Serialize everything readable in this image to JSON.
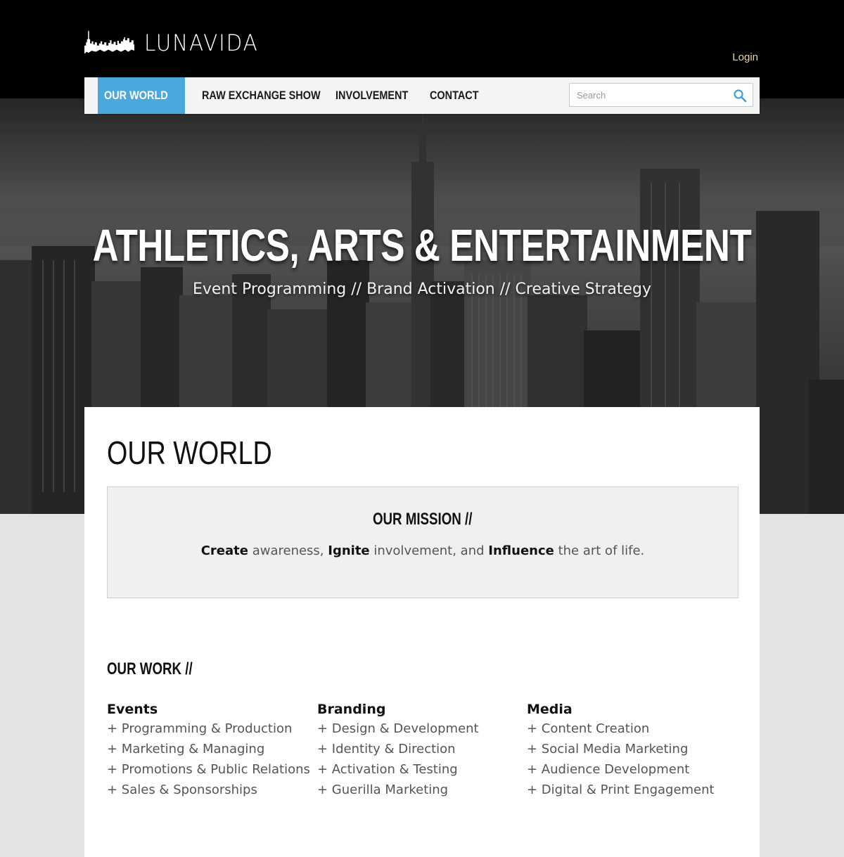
{
  "header": {
    "logo_text": "LUNAVIDA",
    "login_label": "Login"
  },
  "nav": {
    "items": [
      {
        "label": "OUR WORLD",
        "active": true
      },
      {
        "label": "RAW EXCHANGE SHOW",
        "active": false
      },
      {
        "label": "INVOLVEMENT",
        "active": false
      },
      {
        "label": "CONTACT",
        "active": false
      }
    ],
    "search_placeholder": "Search",
    "active_color": "#4aa8dc"
  },
  "hero": {
    "title": "ATHLETICS, ARTS & ENTERTAINMENT",
    "subtitle": "Event Programming // Brand Activation // Creative Strategy"
  },
  "main": {
    "page_title": "OUR WORLD",
    "mission": {
      "heading": "OUR MISSION //",
      "word1": "Create",
      "text1": " awareness, ",
      "word2": "Ignite",
      "text2": " involvement, and ",
      "word3": "Influence",
      "text3": " the art of life."
    },
    "work_heading": "OUR WORK //",
    "columns": [
      {
        "title": "Events",
        "items": [
          "+ Programming & Production",
          "+ Marketing & Managing",
          "+ Promotions & Public Relations",
          "+ Sales & Sponsorships"
        ]
      },
      {
        "title": "Branding",
        "items": [
          "+ Design & Development",
          "+ Identity & Direction",
          "+ Activation & Testing",
          "+ Guerilla Marketing"
        ]
      },
      {
        "title": "Media",
        "items": [
          "+ Content Creation",
          "+ Social Media Marketing",
          "+ Audience Development",
          "+ Digital & Print Engagement"
        ]
      }
    ]
  },
  "icons": {
    "logo": "skyline-icon",
    "search": "search-icon"
  }
}
